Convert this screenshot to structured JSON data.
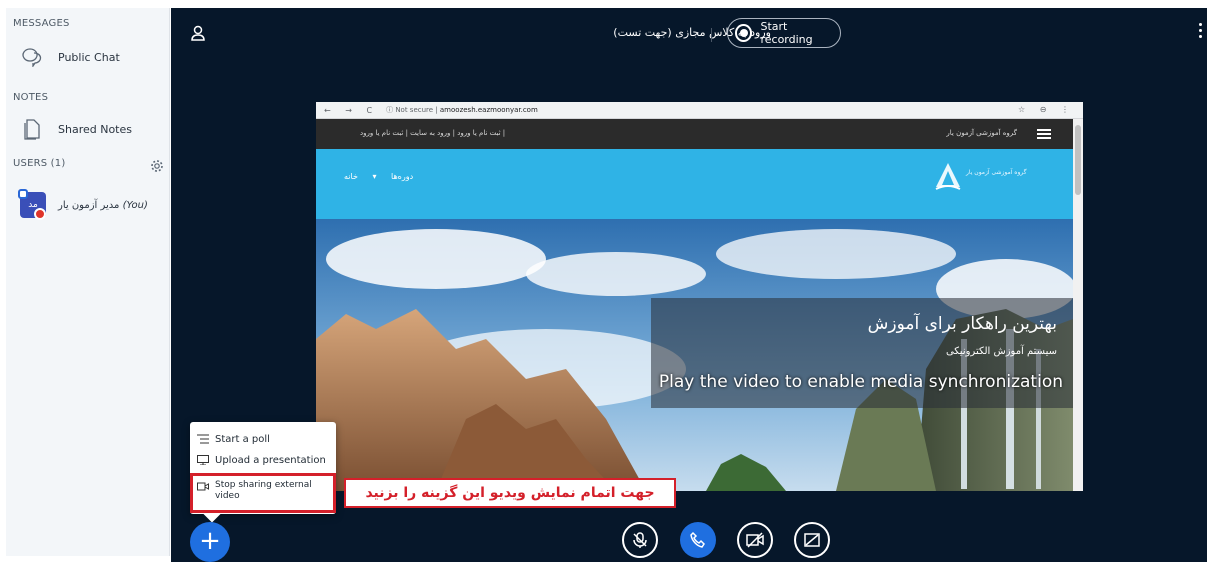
{
  "sidebar": {
    "messages_header": "MESSAGES",
    "public_chat_label": "Public Chat",
    "notes_header": "NOTES",
    "shared_notes_label": "Shared Notes",
    "users_header": "USERS (1)",
    "user": {
      "avatar_initials": "مد",
      "name": "مدیر آزمون یار",
      "you_suffix": "(You)"
    }
  },
  "header": {
    "meeting_title": "ورود به کلاس مجازی (جهت تست)",
    "record_label": "Start recording"
  },
  "video": {
    "browser": {
      "not_secure": "Not secure",
      "url": "amoozesh.eazmoonyar.com"
    },
    "site": {
      "top_links": "ثبت نام یا ورود | ورود به سایت | ثبت نام یا ورود |",
      "brand": "گروه آموزشی آزمون یار",
      "menu": "دوره‌ها ▾   خانه",
      "logo_text": "گروه آموزشی آزمون یار"
    },
    "hero_title": "بهترین راهکار برای آموزش",
    "hero_subtitle": "سیستم آموزش الکترونیکی",
    "sync_message": "Play the video to enable media synchronization"
  },
  "actions_menu": {
    "start_poll": "Start a poll",
    "upload_presentation": "Upload a presentation",
    "stop_sharing": "Stop sharing external video"
  },
  "annotation": "جهت اتمام نمایش ویدیو این گزینه را بزنید",
  "controls": {
    "actions": "+"
  },
  "colors": {
    "main_bg": "#06172a",
    "accent": "#1f6fe0",
    "highlight": "#d4202a"
  }
}
